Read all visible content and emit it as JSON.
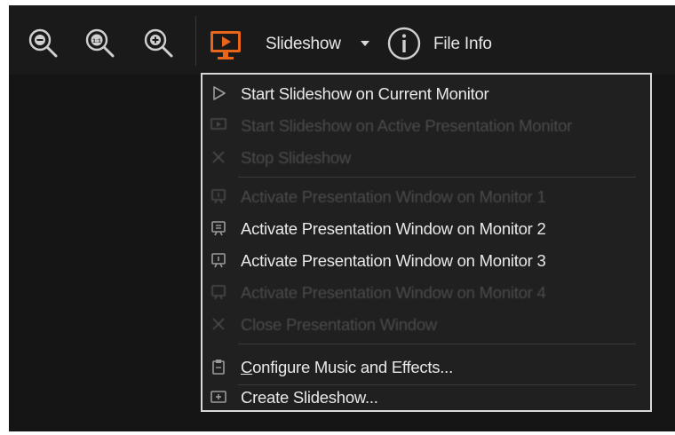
{
  "toolbar": {
    "zoom_out_icon": "zoom-out-icon",
    "zoom_actual_icon": "zoom-actual-size-icon",
    "zoom_in_icon": "zoom-in-icon",
    "slideshow_icon": "monitor-play-icon",
    "slideshow_label": "Slideshow",
    "file_info_icon": "info-icon",
    "file_info_label": "File Info",
    "accent_color": "#e8651a"
  },
  "menu": {
    "items": [
      {
        "label": "Start Slideshow on Current Monitor",
        "icon": "play-outline-icon",
        "enabled": true
      },
      {
        "label": "Start Slideshow on Active Presentation Monitor",
        "icon": "monitor-play-icon",
        "enabled": false
      },
      {
        "label": "Stop Slideshow",
        "icon": "close-icon",
        "enabled": false
      },
      {
        "label": "Activate Presentation Window on Monitor 1",
        "icon": "presentation-window-icon",
        "enabled": false
      },
      {
        "label": "Activate Presentation Window on Monitor 2",
        "icon": "presentation-window-icon",
        "enabled": true
      },
      {
        "label": "Activate Presentation Window on Monitor 3",
        "icon": "presentation-window-icon",
        "enabled": true
      },
      {
        "label": "Activate Presentation Window on Monitor 4",
        "icon": "presentation-window-icon",
        "enabled": false
      },
      {
        "label": "Close Presentation Window",
        "icon": "close-icon",
        "enabled": false
      },
      {
        "label_first": "C",
        "label_rest": "onfigure Music and Effects...",
        "label": "Configure Music and Effects...",
        "icon": "clipboard-icon",
        "enabled": true
      },
      {
        "label": "Create Slideshow...",
        "icon": "create-slideshow-icon",
        "enabled": true
      }
    ]
  }
}
